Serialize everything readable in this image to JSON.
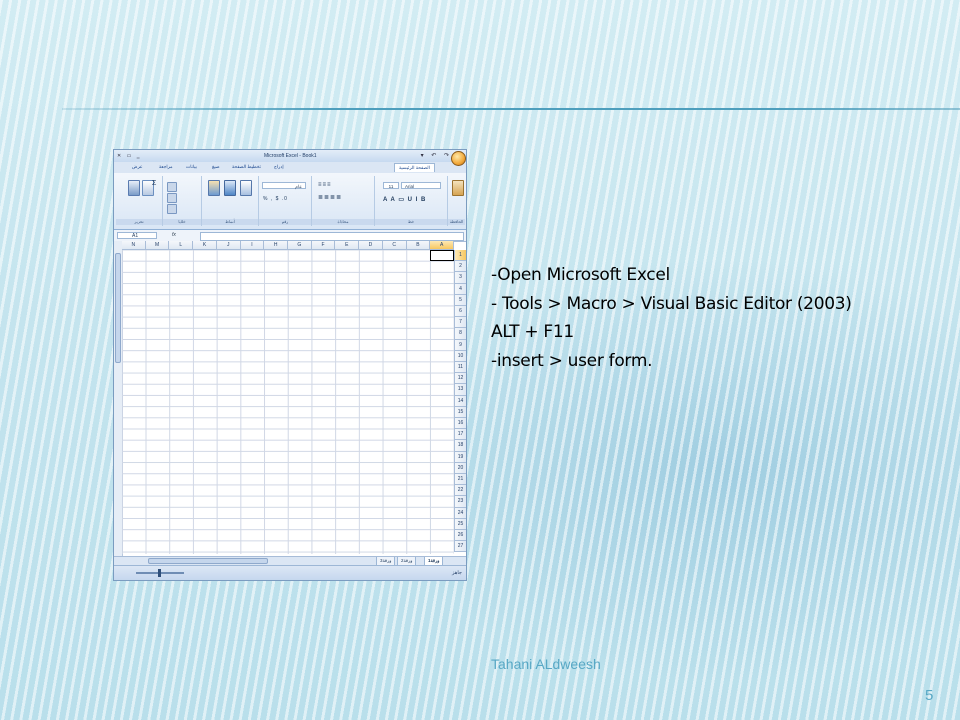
{
  "excel": {
    "title": "Microsoft Excel - Book1",
    "tabs": [
      "الصفحة الرئيسية",
      "إدراج",
      "تخطيط الصفحة",
      "صيغ",
      "بيانات",
      "مراجعة",
      "عرض"
    ],
    "font_name": "Arial",
    "font_size": "11",
    "number_format": "عام",
    "group_labels": [
      "الحافظة",
      "خط",
      "محاذاة",
      "رقم",
      "أنماط",
      "خلايا",
      "تحرير"
    ],
    "name_box": "A1",
    "fx_label": "fx",
    "columns": [
      "N",
      "M",
      "L",
      "K",
      "J",
      "I",
      "H",
      "G",
      "F",
      "E",
      "D",
      "C",
      "B",
      "A"
    ],
    "rows": [
      "1",
      "2",
      "3",
      "4",
      "5",
      "6",
      "7",
      "8",
      "9",
      "10",
      "11",
      "12",
      "13",
      "14",
      "15",
      "16",
      "17",
      "18",
      "19",
      "20",
      "21",
      "22",
      "23",
      "24",
      "25",
      "26",
      "27"
    ],
    "sheet_tabs": [
      "ورقة1",
      "ورقة2",
      "ورقة3"
    ],
    "status": "جاهز"
  },
  "instructions": [
    "-Open Microsoft Excel",
    "- Tools > Macro > Visual Basic Editor (2003)",
    "ALT + F11",
    "-insert > user form."
  ],
  "author": "Tahani ALdweesh",
  "page_number": "5"
}
